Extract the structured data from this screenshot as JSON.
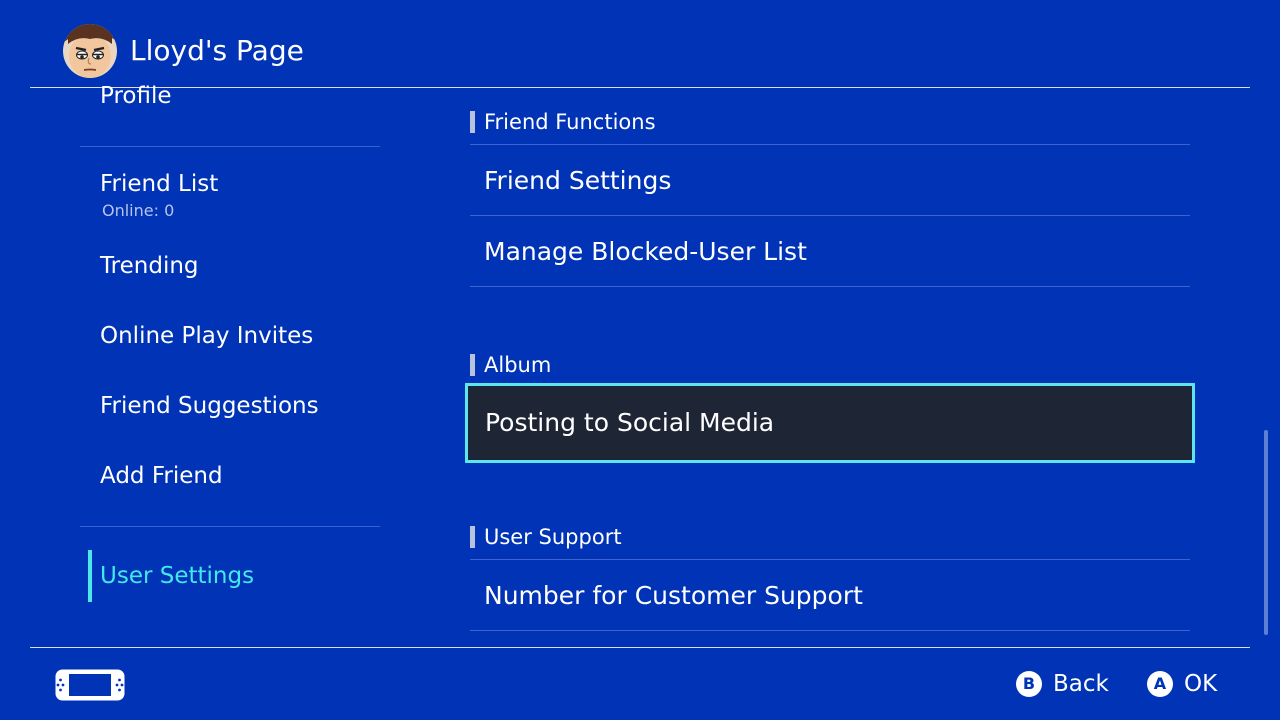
{
  "header": {
    "title": "Lloyd's Page",
    "avatar_icon": "mii-avatar"
  },
  "sidebar": {
    "items": [
      {
        "label": "Profile"
      },
      {
        "label": "Friend List",
        "sub": "Online: 0"
      },
      {
        "label": "Trending"
      },
      {
        "label": "Online Play Invites"
      },
      {
        "label": "Friend Suggestions"
      },
      {
        "label": "Add Friend"
      },
      {
        "label": "User Settings",
        "active": true
      }
    ]
  },
  "main": {
    "sections": [
      {
        "heading": "Friend Functions",
        "items": [
          "Friend Settings",
          "Manage Blocked-User List"
        ]
      },
      {
        "heading": "Album",
        "items": [
          "Posting to Social Media"
        ]
      },
      {
        "heading": "User Support",
        "items": [
          "Number for Customer Support"
        ]
      }
    ],
    "selected_item": "Posting to Social Media"
  },
  "footer": {
    "console_icon": "handheld-console-icon",
    "buttons": [
      {
        "glyph": "B",
        "label": "Back"
      },
      {
        "glyph": "A",
        "label": "OK"
      }
    ]
  },
  "colors": {
    "background": "#0033b5",
    "accent": "#43e8ee",
    "selected_bg": "#1e2535"
  }
}
